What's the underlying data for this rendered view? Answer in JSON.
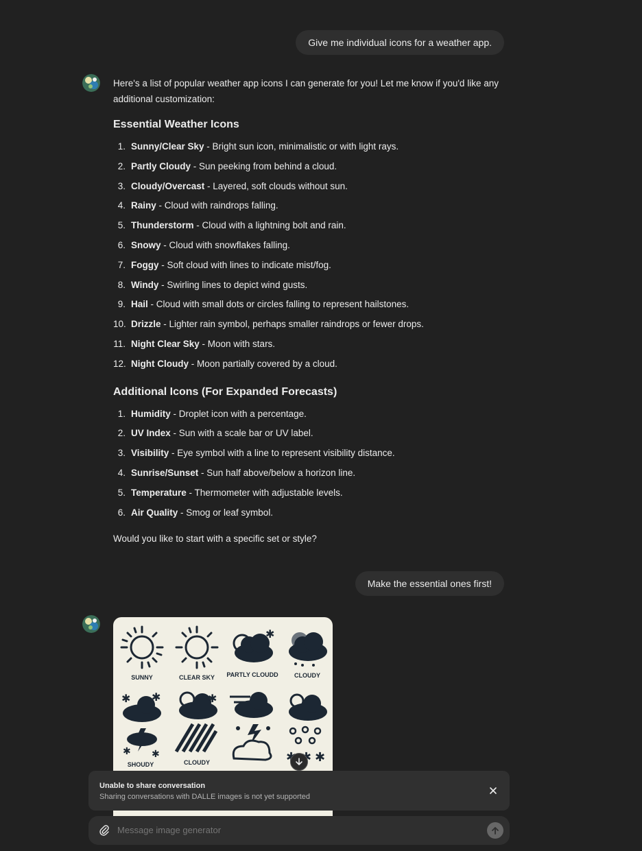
{
  "messages": {
    "user1": "Give me individual icons for a weather app.",
    "assistant_intro": "Here's a list of popular weather app icons I can generate for you! Let me know if you'd like any additional customization:",
    "section1_title": "Essential Weather Icons",
    "essential": [
      {
        "num": "1.",
        "name": "Sunny/Clear Sky",
        "desc": " - Bright sun icon, minimalistic or with light rays."
      },
      {
        "num": "2.",
        "name": "Partly Cloudy",
        "desc": " - Sun peeking from behind a cloud."
      },
      {
        "num": "3.",
        "name": "Cloudy/Overcast",
        "desc": " - Layered, soft clouds without sun."
      },
      {
        "num": "4.",
        "name": "Rainy",
        "desc": " - Cloud with raindrops falling."
      },
      {
        "num": "5.",
        "name": "Thunderstorm",
        "desc": " - Cloud with a lightning bolt and rain."
      },
      {
        "num": "6.",
        "name": "Snowy",
        "desc": " - Cloud with snowflakes falling."
      },
      {
        "num": "7.",
        "name": "Foggy",
        "desc": " - Soft cloud with lines to indicate mist/fog."
      },
      {
        "num": "8.",
        "name": "Windy",
        "desc": " - Swirling lines to depict wind gusts."
      },
      {
        "num": "9.",
        "name": "Hail",
        "desc": " - Cloud with small dots or circles falling to represent hailstones."
      },
      {
        "num": "10.",
        "name": "Drizzle",
        "desc": " - Lighter rain symbol, perhaps smaller raindrops or fewer drops."
      },
      {
        "num": "11.",
        "name": "Night Clear Sky",
        "desc": " - Moon with stars."
      },
      {
        "num": "12.",
        "name": "Night Cloudy",
        "desc": " - Moon partially covered by a cloud."
      }
    ],
    "section2_title": "Additional Icons (For Expanded Forecasts)",
    "additional": [
      {
        "num": "1.",
        "name": "Humidity",
        "desc": " - Droplet icon with a percentage."
      },
      {
        "num": "2.",
        "name": "UV Index",
        "desc": " - Sun with a scale bar or UV label."
      },
      {
        "num": "3.",
        "name": "Visibility",
        "desc": " - Eye symbol with a line to represent visibility distance."
      },
      {
        "num": "4.",
        "name": "Sunrise/Sunset",
        "desc": " - Sun half above/below a horizon line."
      },
      {
        "num": "5.",
        "name": "Temperature",
        "desc": " - Thermometer with adjustable levels."
      },
      {
        "num": "6.",
        "name": "Air Quality",
        "desc": " - Smog or leaf symbol."
      }
    ],
    "closing": "Would you like to start with a specific set or style?",
    "user2": "Make the essential ones first!"
  },
  "image_labels": [
    "SUNNY",
    "CLEAR SKY",
    "PARTLY CLOUDD",
    "CLOUDY",
    "SHOUDY",
    "CLOUDY"
  ],
  "toast": {
    "title": "Unable to share conversation",
    "message": "Sharing conversations with DALLE images is not yet supported"
  },
  "composer": {
    "placeholder": "Message image generator"
  },
  "icons": {
    "avatar": "assistant-avatar",
    "download": "arrow-down-icon",
    "close": "close-icon",
    "attach": "paperclip-icon",
    "send": "arrow-up-icon"
  }
}
